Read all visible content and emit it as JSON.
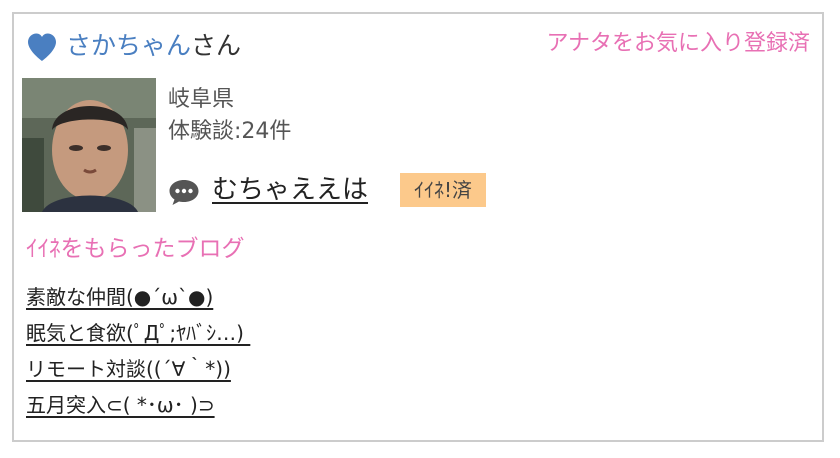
{
  "user": {
    "name": "さかちゃん",
    "honorific": "さん",
    "favorite_status": "アナタをお気に入り登録済",
    "prefecture": "岐阜県",
    "review_count": "体験談:24件"
  },
  "latest": {
    "title": "むちゃええは",
    "like_badge": "ｲｲﾈ!済"
  },
  "liked_blogs": {
    "title": "ｲｲﾈをもらったブログ",
    "items": [
      "素敵な仲間(●´ω`●)",
      "眠気と食欲(ﾟДﾟ;ﾔﾊﾞｼ…) ",
      "リモート対談((´∀｀*))",
      "五月突入⊂( *･ω･ )⊃"
    ]
  },
  "colors": {
    "name_blue": "#4a7fc1",
    "accent_pink": "#e870b4",
    "badge_orange": "#fcc98b",
    "border_gray": "#cccccc"
  },
  "icons": {
    "favorite": "heart-icon",
    "comment": "speech-bubble-icon"
  }
}
